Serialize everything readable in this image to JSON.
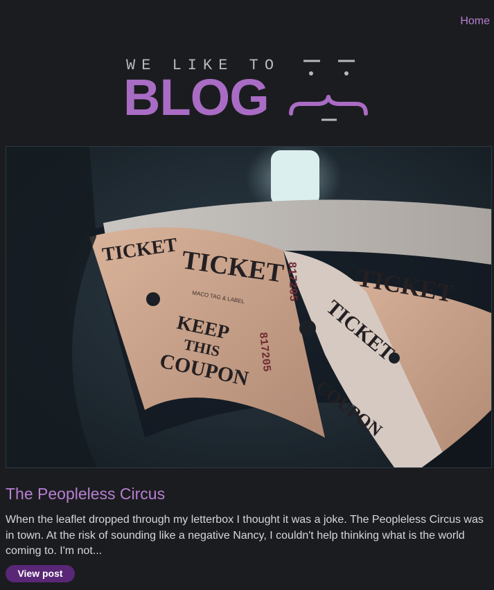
{
  "nav": {
    "home_label": "Home"
  },
  "logo": {
    "tagline": "WE LIKE TO",
    "wordmark": "BLOG"
  },
  "hero": {
    "ticket_word": "TICKET",
    "keep_word": "KEEP",
    "this_word": "THIS",
    "coupon_word": "COUPON",
    "serial": "817205",
    "maker": "MACO TAG & LABEL"
  },
  "post": {
    "title": "The Peopleless Circus",
    "excerpt": "When the leaflet dropped through my letterbox I thought it was a joke. The Peopleless Circus was in town. At the risk of sounding like a negative Nancy, I couldn't help thinking what is the world coming to. I'm not...",
    "button_label": "View post"
  },
  "colors": {
    "background": "#1b1c1f",
    "accent": "#b77fd3",
    "logo_purple": "#a96cc4",
    "button": "#5a2777"
  }
}
